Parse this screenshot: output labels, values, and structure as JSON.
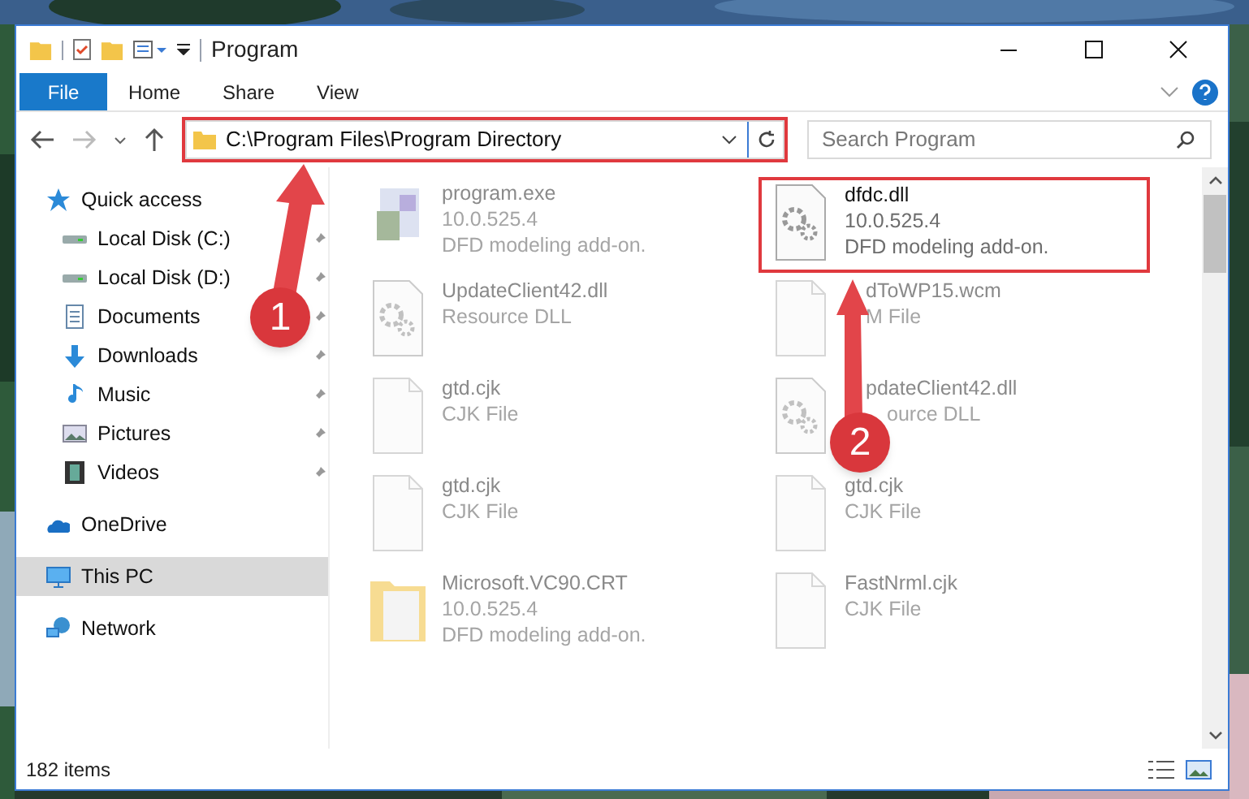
{
  "window": {
    "title": "Program"
  },
  "ribbon_tabs": [
    {
      "label": "File",
      "kind": "file"
    },
    {
      "label": "Home",
      "kind": "tab"
    },
    {
      "label": "Share",
      "kind": "tab"
    },
    {
      "label": "View",
      "kind": "tab"
    }
  ],
  "address": {
    "path": "C:\\Program Files\\Program Directory",
    "highlighted": true
  },
  "search": {
    "placeholder": "Search Program"
  },
  "navigation": [
    {
      "label": "Quick access",
      "kind": "star",
      "selected": false,
      "children": [
        {
          "label": "Local Disk (C:)",
          "kind": "drive",
          "selected": false
        },
        {
          "label": "Local Disk (D:)",
          "kind": "drive",
          "selected": false
        },
        {
          "label": "Documents",
          "kind": "document",
          "selected": false
        },
        {
          "label": "Downloads",
          "kind": "download",
          "selected": false
        },
        {
          "label": "Music",
          "kind": "music",
          "selected": false
        },
        {
          "label": "Pictures",
          "kind": "pictures",
          "selected": false
        },
        {
          "label": "Videos",
          "kind": "videos",
          "selected": false
        }
      ]
    },
    {
      "label": "OneDrive",
      "kind": "cloud",
      "selected": false
    },
    {
      "label": "This PC",
      "kind": "pc",
      "selected": true
    },
    {
      "label": "Network",
      "kind": "network",
      "selected": false
    }
  ],
  "files": [
    {
      "name": "program.exe",
      "details": [
        "10.0.525.4",
        "DFD modeling add-on."
      ],
      "kind": "exe",
      "highlighted": false
    },
    {
      "name": "dfdc.dll",
      "details": [
        "10.0.525.4",
        "DFD modeling add-on."
      ],
      "kind": "gear",
      "highlighted": true
    },
    {
      "name": "UpdateClient42.dll",
      "details": [
        "Resource DLL"
      ],
      "kind": "gear",
      "highlighted": false
    },
    {
      "name": "dToWP15.wcm",
      "details": [
        "M File"
      ],
      "kind": "blank",
      "highlighted": false
    },
    {
      "name": "gtd.cjk",
      "details": [
        "CJK File"
      ],
      "kind": "blank",
      "highlighted": false
    },
    {
      "name": "pdateClient42.dll",
      "details": [
        "ource DLL"
      ],
      "kind": "gear",
      "highlighted": false
    },
    {
      "name": "gtd.cjk",
      "details": [
        "CJK File"
      ],
      "kind": "blank",
      "highlighted": false
    },
    {
      "name": "gtd.cjk",
      "details": [
        "CJK File"
      ],
      "kind": "blank",
      "highlighted": false
    },
    {
      "name": "Microsoft.VC90.CRT",
      "details": [
        "10.0.525.4",
        "DFD modeling add-on."
      ],
      "kind": "folder",
      "highlighted": false
    },
    {
      "name": "FastNrml.cjk",
      "details": [
        "CJK File"
      ],
      "kind": "blank",
      "highlighted": false
    }
  ],
  "status_bar": {
    "item_count": "182 items"
  },
  "callouts": [
    {
      "number": "1"
    },
    {
      "number": "2"
    }
  ]
}
